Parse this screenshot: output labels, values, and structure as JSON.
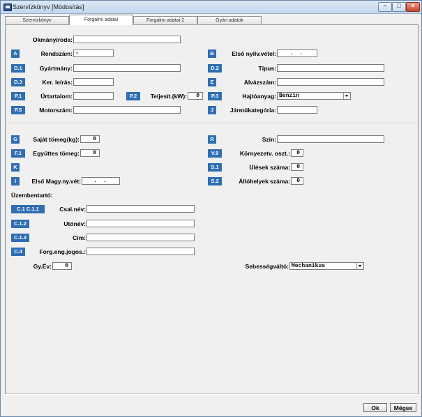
{
  "window": {
    "title": "Szervízkönyv [Módosítás]",
    "minimize_glyph": "–",
    "maximize_glyph": "□",
    "close_glyph": "×"
  },
  "tabs": [
    {
      "label": "Szervízkönyv"
    },
    {
      "label": "Forgalmi adatai"
    },
    {
      "label": "Forgalmi adatai 2"
    },
    {
      "label": "Gyári adatok"
    }
  ],
  "active_tab": "Forgalmi adatai",
  "fields": {
    "okmanyiroda": {
      "label": "Okmányiroda:",
      "value": ""
    },
    "rendszam": {
      "code": "A",
      "label": "Rendszám:",
      "value": "-"
    },
    "elso_nyilv": {
      "code": "B",
      "label": "Első nyilv.vétel:",
      "value": ". ."
    },
    "gyartmany": {
      "code": "D.1",
      "label": "Gyártmány:",
      "value": ""
    },
    "tipus": {
      "code": "D.2",
      "label": "Típus:",
      "value": ""
    },
    "ker_leiras": {
      "code": "D.3",
      "label": "Ker. leírás:",
      "value": ""
    },
    "alvazszam": {
      "code": "E",
      "label": "Alvázszám:",
      "value": ""
    },
    "urtartalom": {
      "code": "P.1",
      "label": "Űrtartalom:",
      "value": ""
    },
    "teljesitmeny": {
      "code": "P.2",
      "label": "Teljesít.(kW):",
      "value": "0"
    },
    "hajtoanyag": {
      "code": "P.3",
      "label": "Hajtóanyag:",
      "value": "Benzin"
    },
    "motorszam": {
      "code": "P.5",
      "label": "Motorszám:",
      "value": ""
    },
    "jarmukategoria": {
      "code": "J",
      "label": "Járműkategória:",
      "value": ""
    },
    "sajat_tomeg": {
      "code": "G",
      "label": "Saját tömeg(kg):",
      "value": "0"
    },
    "szin": {
      "code": "R",
      "label": "Szín:",
      "value": ""
    },
    "egyuttes_tomeg": {
      "code": "F.1",
      "label": "Együttes tömeg:",
      "value": "0"
    },
    "kornyezetv": {
      "code": "V.9",
      "label": "Környezetv. oszt.:",
      "value": "0"
    },
    "k_code": {
      "code": "K"
    },
    "ulesek": {
      "code": "S.1",
      "label": "Ülések száma:",
      "value": "0"
    },
    "elso_magy": {
      "code": "I",
      "label": "Első Magy.ny.vét:",
      "value": ". ."
    },
    "allohelyek": {
      "code": "S.2",
      "label": "Állóhelyek száma:",
      "value": "0"
    }
  },
  "uzembentarto": {
    "section_label": "Üzembentartó:",
    "csal_nev": {
      "codes": "C.1 C.1.1",
      "label": "Csal.név:",
      "value": ""
    },
    "utonev": {
      "code": "C.1.2",
      "label": "Utónév:",
      "value": ""
    },
    "cim": {
      "code": "C.1.3",
      "label": "Cím:",
      "value": ""
    },
    "forg_eng": {
      "code": "C.4",
      "label": "Forg.eng.jogos.:",
      "value": ""
    }
  },
  "gy_ev": {
    "label": "Gy.Év:",
    "value": "0"
  },
  "sebessegvalto": {
    "label": "Sebességváltó:",
    "value": "Mechanikus"
  },
  "buttons": {
    "ok": "Ok",
    "cancel": "Mégse"
  }
}
